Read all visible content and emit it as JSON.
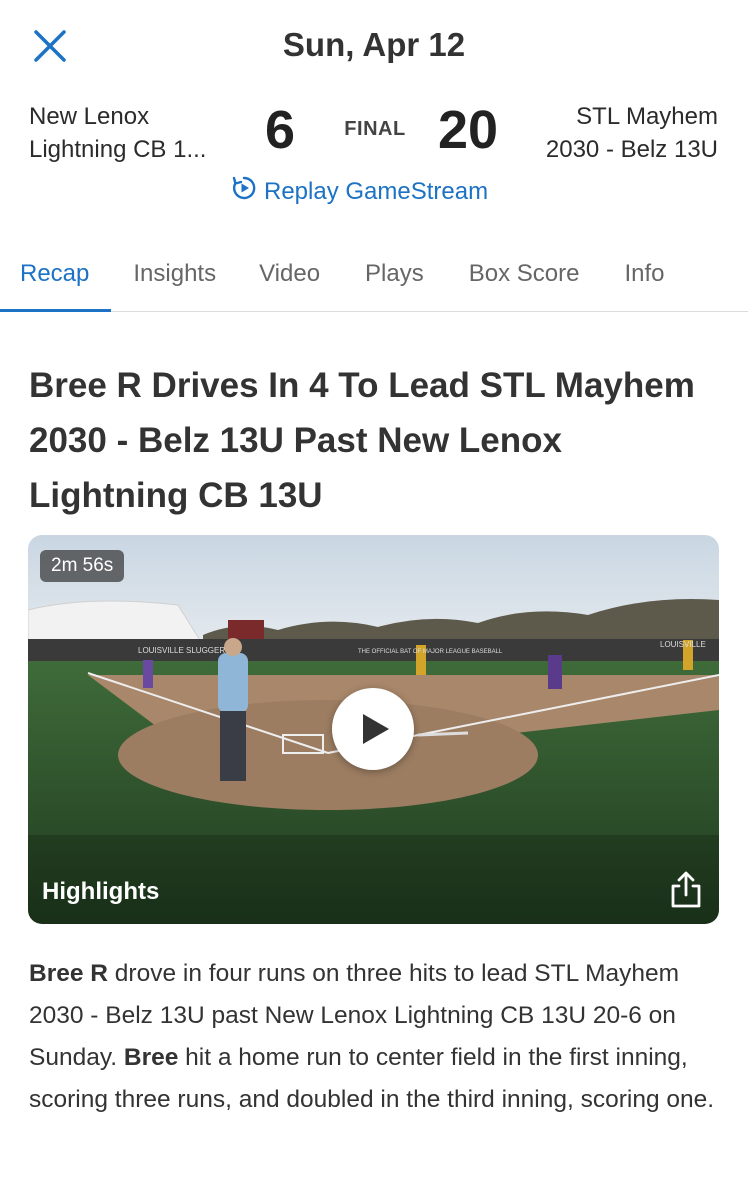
{
  "header": {
    "date": "Sun, Apr 12",
    "home_team_line1": "New Lenox",
    "home_team_line2": "Lightning CB 1...",
    "home_score": "6",
    "status": "FINAL",
    "away_score": "20",
    "away_team_line1": "STL Mayhem",
    "away_team_line2": "2030 - Belz 13U",
    "replay_label": "Replay GameStream"
  },
  "tabs": [
    {
      "label": "Recap",
      "active": true
    },
    {
      "label": "Insights",
      "active": false
    },
    {
      "label": "Video",
      "active": false
    },
    {
      "label": "Plays",
      "active": false
    },
    {
      "label": "Box Score",
      "active": false
    },
    {
      "label": "Info",
      "active": false
    }
  ],
  "article": {
    "headline": "Bree R Drives In 4 To Lead STL Mayhem 2030 - Belz 13U Past New Lenox Lightning CB 13U",
    "video": {
      "duration": "2m 56s",
      "label": "Highlights",
      "signage_left": "LOUISVILLE SLUGGER",
      "signage_center": "THE OFFICIAL BAT OF MAJOR LEAGUE BASEBALL",
      "signage_right": "LOUISVILLE"
    },
    "body": {
      "p1_bold": "Bree R",
      "p1_text": " drove in four runs on three hits to lead STL Mayhem 2030 - Belz 13U past New Lenox Lightning CB 13U 20-6 on Sunday. ",
      "p2_bold": "Bree",
      "p2_text": " hit a home run to center field in the first inning, scoring three runs, and doubled in the third inning, scoring one."
    }
  },
  "colors": {
    "accent": "#1c72c4",
    "text": "#333333"
  }
}
